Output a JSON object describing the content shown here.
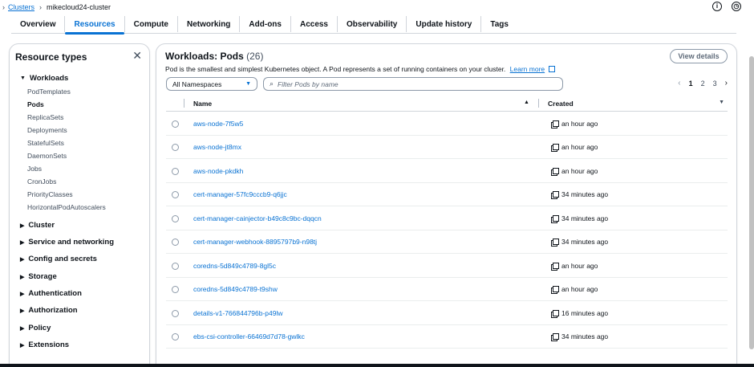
{
  "breadcrumb": {
    "root": "Clusters",
    "current": "mikecloud24-cluster"
  },
  "tabs": [
    "Overview",
    "Resources",
    "Compute",
    "Networking",
    "Add-ons",
    "Access",
    "Observability",
    "Update history",
    "Tags"
  ],
  "active_tab": "Resources",
  "sidebar": {
    "title": "Resource types",
    "workloads_label": "Workloads",
    "workload_items": [
      "PodTemplates",
      "Pods",
      "ReplicaSets",
      "Deployments",
      "StatefulSets",
      "DaemonSets",
      "Jobs",
      "CronJobs",
      "PriorityClasses",
      "HorizontalPodAutoscalers"
    ],
    "active_item": "Pods",
    "groups": [
      "Cluster",
      "Service and networking",
      "Config and secrets",
      "Storage",
      "Authentication",
      "Authorization",
      "Policy",
      "Extensions"
    ]
  },
  "main": {
    "title": "Workloads: Pods",
    "count": "(26)",
    "description": "Pod is the smallest and simplest Kubernetes object. A Pod represents a set of running containers on your cluster.",
    "learn_more": "Learn more",
    "view_details": "View details",
    "namespace_select": "All Namespaces",
    "filter_placeholder": "Filter Pods by name",
    "pages": [
      "1",
      "2",
      "3"
    ],
    "current_page": "1",
    "columns": {
      "name": "Name",
      "created": "Created"
    },
    "rows": [
      {
        "name": "aws-node-7f5w5",
        "created": "an hour ago"
      },
      {
        "name": "aws-node-jt8mx",
        "created": "an hour ago"
      },
      {
        "name": "aws-node-pkdkh",
        "created": "an hour ago"
      },
      {
        "name": "cert-manager-57fc9cccb9-q6jjc",
        "created": "34 minutes ago"
      },
      {
        "name": "cert-manager-cainjector-b49c8c9bc-dqqcn",
        "created": "34 minutes ago"
      },
      {
        "name": "cert-manager-webhook-8895797b9-n98tj",
        "created": "34 minutes ago"
      },
      {
        "name": "coredns-5d849c4789-8gl5c",
        "created": "an hour ago"
      },
      {
        "name": "coredns-5d849c4789-t9shw",
        "created": "an hour ago"
      },
      {
        "name": "details-v1-766844796b-p49lw",
        "created": "16 minutes ago"
      },
      {
        "name": "ebs-csi-controller-66469d7d78-gwlkc",
        "created": "34 minutes ago"
      }
    ]
  },
  "colors": {
    "accent": "#0972d3",
    "text": "#0f141a",
    "border": "#d1d5db"
  },
  "icons": {
    "info": "info-icon",
    "settings": "settings-icon",
    "search": "search-icon",
    "copy": "copy-icon",
    "external": "external-link-icon"
  }
}
